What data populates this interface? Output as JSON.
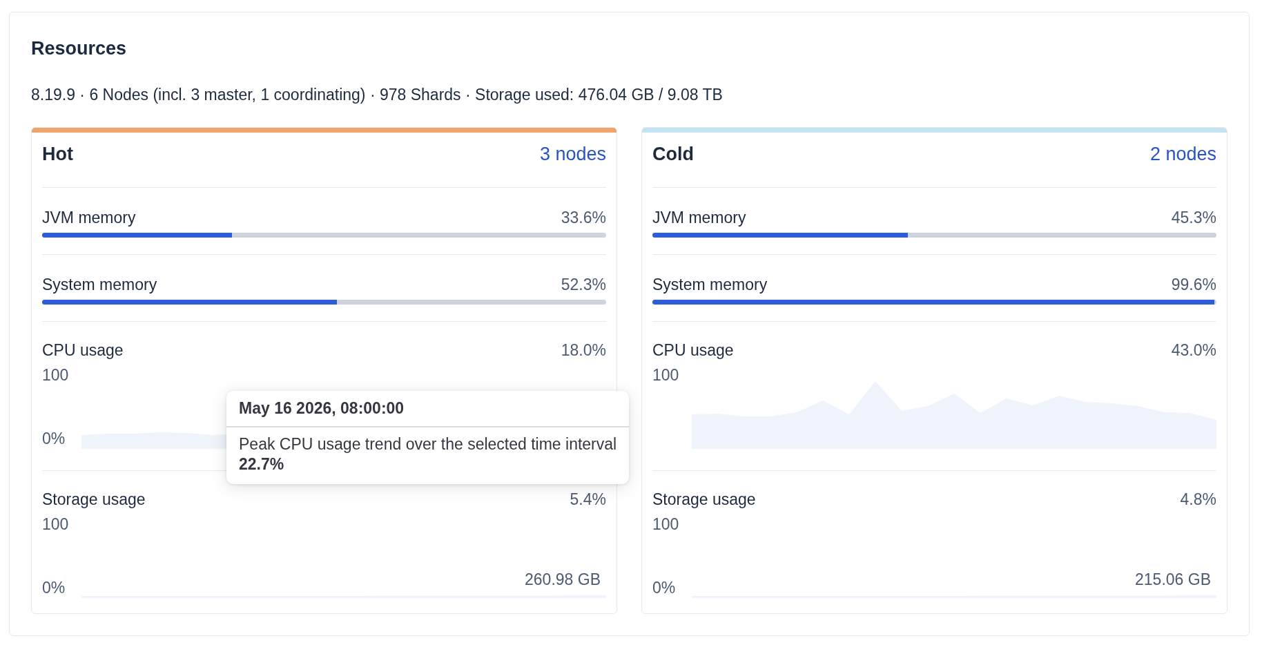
{
  "panel": {
    "title": "Resources",
    "summary": "8.19.9 · 6 Nodes (incl. 3 master, 1 coordinating) · 978 Shards · Storage used: 476.04 GB / 9.08 TB"
  },
  "tiers": [
    {
      "name": "Hot",
      "node_count": "3 nodes",
      "color": "#f0a46c",
      "metrics": [
        {
          "kind": "bar",
          "label": "JVM memory",
          "reading": "33.6%",
          "level": 0.336
        },
        {
          "kind": "bar",
          "label": "System memory",
          "reading": "52.3%",
          "level": 0.523
        },
        {
          "kind": "sparkline",
          "label": "CPU usage",
          "reading": "18.0%",
          "axis_max": "100",
          "axis_min": "0%"
        },
        {
          "kind": "sparkline",
          "label": "Storage usage",
          "reading": "5.4%",
          "axis_max": "100",
          "axis_min": "0%",
          "last_value": "260.98 GB"
        }
      ]
    },
    {
      "name": "Cold",
      "node_count": "2 nodes",
      "color": "#c4e4f3",
      "metrics": [
        {
          "kind": "bar",
          "label": "JVM memory",
          "reading": "45.3%",
          "level": 0.453
        },
        {
          "kind": "bar",
          "label": "System memory",
          "reading": "99.6%",
          "level": 0.996
        },
        {
          "kind": "sparkline",
          "label": "CPU usage",
          "reading": "43.0%",
          "axis_max": "100"
        },
        {
          "kind": "sparkline",
          "label": "Storage usage",
          "reading": "4.8%",
          "axis_max": "100",
          "axis_min": "0%",
          "last_value": "215.06 GB"
        }
      ]
    }
  ],
  "tooltip": {
    "time": "May 16 2026, 08:00:00",
    "description": "Peak CPU usage trend over the selected time interval",
    "value": "22.7%"
  }
}
